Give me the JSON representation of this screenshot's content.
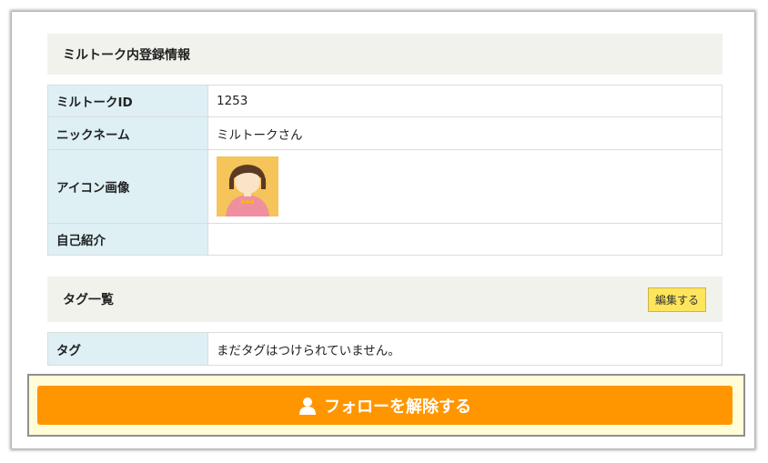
{
  "profile": {
    "section_title": "ミルトーク内登録情報",
    "rows": [
      {
        "label": "ミルトークID",
        "value": "1253"
      },
      {
        "label": "ニックネーム",
        "value": "ミルトークさん"
      },
      {
        "label": "アイコン画像",
        "value": ""
      },
      {
        "label": "自己紹介",
        "value": ""
      }
    ]
  },
  "tags": {
    "section_title": "タグ一覧",
    "edit_label": "編集する",
    "label": "タグ",
    "value": "まだタグはつけられていません。"
  },
  "action": {
    "unfollow_label": "フォローを解除する",
    "icon": "user-icon"
  },
  "colors": {
    "accent": "#ff9600",
    "label_bg": "#def0f4",
    "section_bg": "#f2f2ed",
    "edit_button": "#ffe55c"
  }
}
